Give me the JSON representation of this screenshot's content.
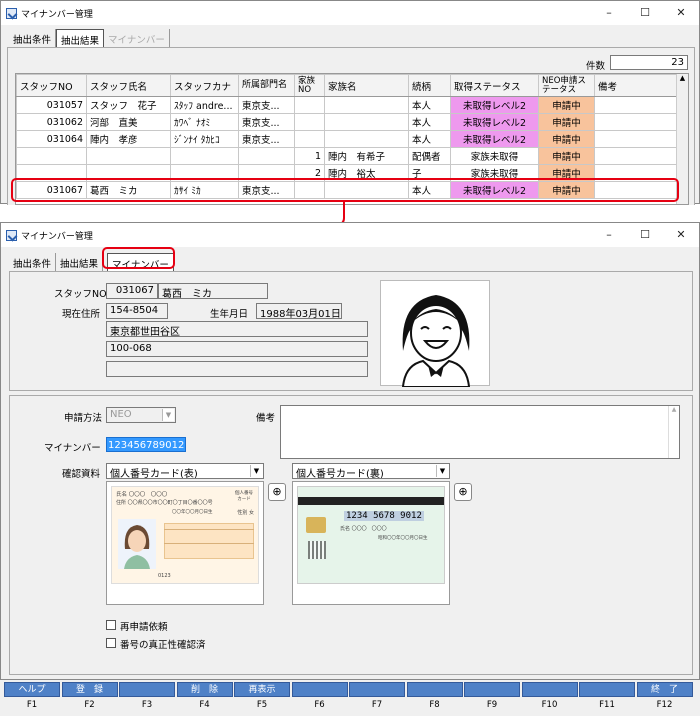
{
  "window_title": "マイナンバー管理",
  "window_controls": {
    "minimize": "–",
    "maximize": "☐",
    "close": "✕"
  },
  "top": {
    "tabs": [
      "抽出条件",
      "抽出結果",
      "マイナンバー"
    ],
    "count_label": "件数",
    "count_value": "23",
    "columns": [
      "スタッフNO",
      "スタッフ氏名",
      "スタッフカナ",
      "所属部門名",
      "家族NO",
      "家族名",
      "続柄",
      "取得ステータス",
      "NEO申請ステータス",
      "備考"
    ],
    "rows": [
      [
        "031057",
        "スタッフ　花子",
        "ｽﾀｯﾌ andre...",
        "東京支...",
        "",
        "",
        "本人",
        "未取得レベル2",
        "申請中",
        ""
      ],
      [
        "031062",
        "河部　直美",
        "ｶﾜﾍﾞ ﾅｵﾐ",
        "東京支...",
        "",
        "",
        "本人",
        "未取得レベル2",
        "申請中",
        ""
      ],
      [
        "031064",
        "陣内　孝彦",
        "ｼﾞﾝﾅｲ ﾀｶﾋｺ",
        "東京支...",
        "",
        "",
        "本人",
        "未取得レベル2",
        "申請中",
        ""
      ],
      [
        "",
        "",
        "",
        "",
        "1",
        "陣内　有希子",
        "配偶者",
        "家族未取得",
        "申請中",
        ""
      ],
      [
        "",
        "",
        "",
        "",
        "2",
        "陣内　裕太",
        "子",
        "家族未取得",
        "申請中",
        ""
      ],
      [
        "031067",
        "葛西　ミカ",
        "ｶｻｲ ﾐｶ",
        "東京支...",
        "",
        "",
        "本人",
        "未取得レベル2",
        "申請中",
        ""
      ]
    ]
  },
  "bottom": {
    "tabs": [
      "抽出条件",
      "抽出結果",
      "マイナンバー"
    ],
    "staff_no_label": "スタッフNO",
    "staff_no": "031067",
    "staff_name": "葛西　ミカ",
    "address_label": "現在住所",
    "postal": "154-8504",
    "birth_label": "生年月日",
    "birth": "1988年03月01日",
    "address1": "東京都世田谷区",
    "address2": "100-068",
    "address3": "",
    "method_label": "申請方法",
    "method": "NEO",
    "remarks_label": "備考",
    "mynumber_label": "マイナンバー",
    "mynumber": "123456789012",
    "docs_label": "確認資料",
    "doc_front": "個人番号カード(表)",
    "doc_back": "個人番号カード(裏)",
    "card_number": "1234  5678  9012",
    "card_front_text": [
      "氏名 〇〇〇　〇〇〇",
      "住所 〇〇県〇〇市〇〇町〇丁目〇番〇〇号",
      "〇〇年〇〇月〇日生"
    ],
    "card_front_header": "個人番号カード",
    "card_front_sex": "性別 女",
    "card_front_footer": "0123",
    "card_back_text": [
      "氏名 〇〇〇　〇〇〇",
      "昭和〇〇年〇〇月〇日生"
    ],
    "reapply_label": "再申請依頼",
    "verified_label": "番号の真正性確認済"
  },
  "fkeys": [
    {
      "label": "ヘルプ",
      "key": "F1"
    },
    {
      "label": "登　録",
      "key": "F2"
    },
    {
      "label": "",
      "key": "F3"
    },
    {
      "label": "削　除",
      "key": "F4"
    },
    {
      "label": "再表示",
      "key": "F5"
    },
    {
      "label": "",
      "key": "F6"
    },
    {
      "label": "",
      "key": "F7"
    },
    {
      "label": "",
      "key": "F8"
    },
    {
      "label": "",
      "key": "F9"
    },
    {
      "label": "",
      "key": "F10"
    },
    {
      "label": "",
      "key": "F11"
    },
    {
      "label": "終　了",
      "key": "F12"
    }
  ],
  "colors": {
    "accent": "#e60012",
    "pink_status": "#ee99ee",
    "orange_status": "#f8c39c",
    "fkey_blue": "#4f81c7"
  }
}
